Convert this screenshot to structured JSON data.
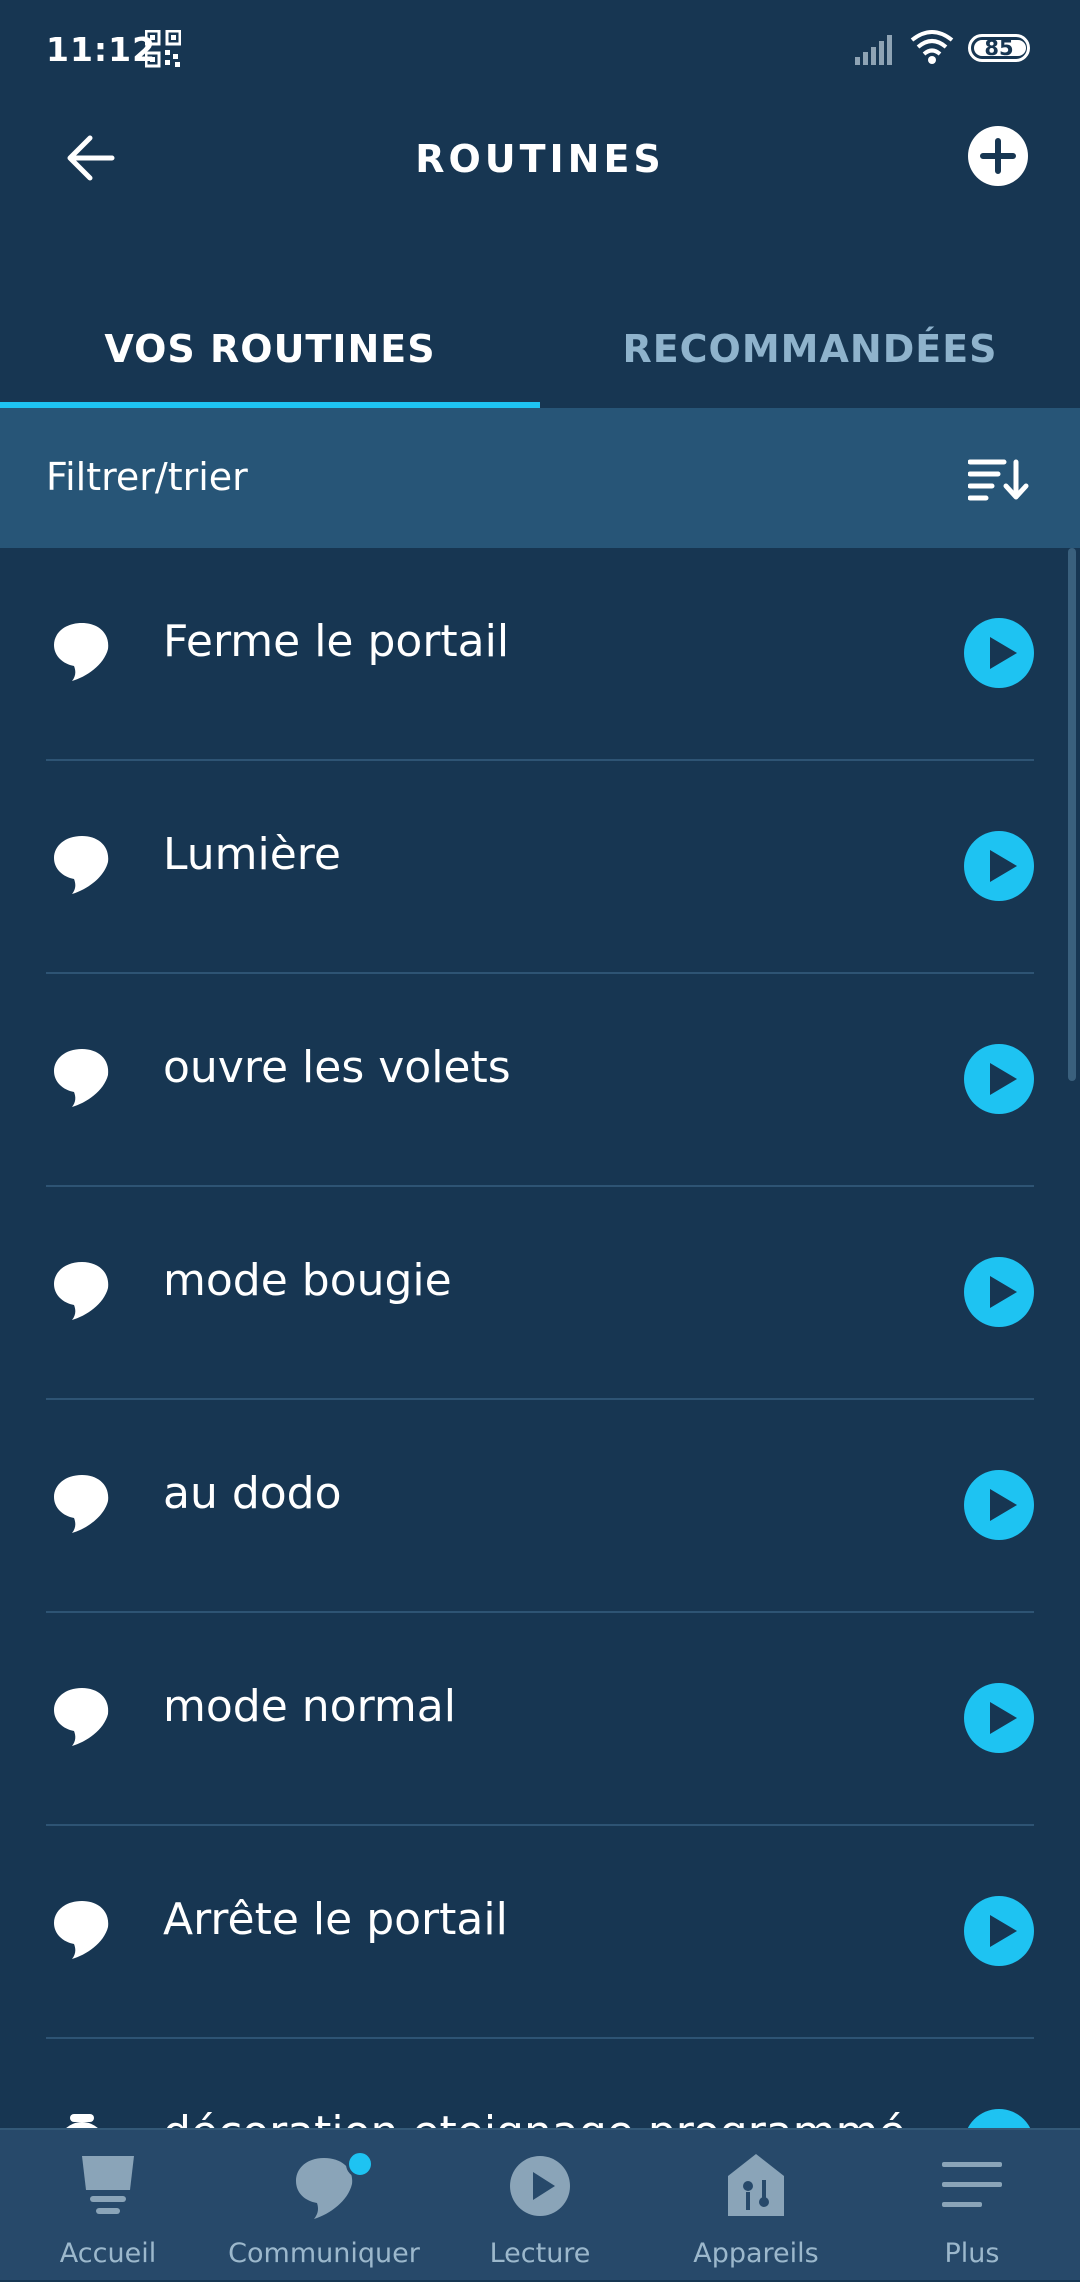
{
  "status": {
    "time": "11:12",
    "battery": "85"
  },
  "header": {
    "title": "ROUTINES"
  },
  "tabs": [
    {
      "label": "VOS ROUTINES",
      "active": true
    },
    {
      "label": "RECOMMANDÉES",
      "active": false
    }
  ],
  "filter": {
    "label": "Filtrer/trier"
  },
  "routines": [
    {
      "label": "Ferme le portail"
    },
    {
      "label": "Lumière"
    },
    {
      "label": "ouvre les volets"
    },
    {
      "label": "mode bougie"
    },
    {
      "label": "au dodo"
    },
    {
      "label": "mode normal"
    },
    {
      "label": "Arrête le portail"
    },
    {
      "label": "décoration eteignage programmé"
    }
  ],
  "bottom_nav": [
    {
      "label": "Accueil",
      "icon": "home-icon"
    },
    {
      "label": "Communiquer",
      "icon": "communicate-icon"
    },
    {
      "label": "Lecture",
      "icon": "play-icon"
    },
    {
      "label": "Appareils",
      "icon": "devices-icon"
    },
    {
      "label": "Plus",
      "icon": "menu-icon"
    }
  ],
  "colors": {
    "background": "#173652",
    "accent": "#1ec3f2",
    "filter_bar": "#275577",
    "nav_bar": "#27496a"
  }
}
